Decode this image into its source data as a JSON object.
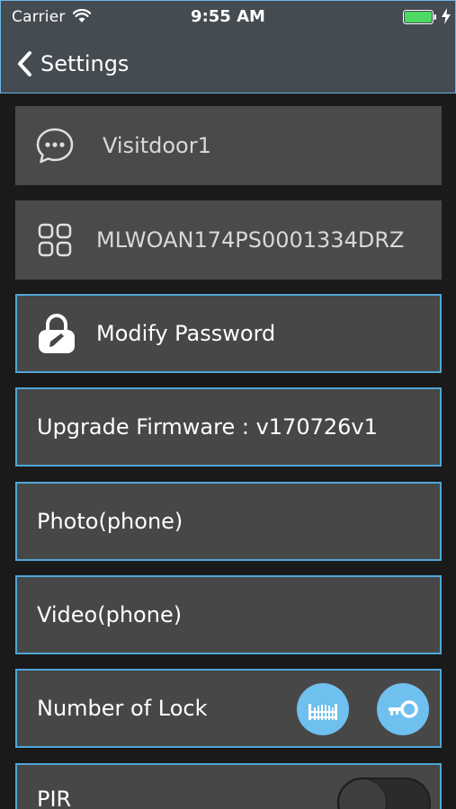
{
  "status_bar": {
    "carrier": "Carrier",
    "time": "9:55 AM",
    "battery_color": "#4cd964",
    "wifi_icon": "wifi-icon",
    "battery_icon": "battery-icon",
    "charging_icon": "charging-bolt-icon"
  },
  "nav": {
    "back_label": "Settings",
    "back_icon": "chevron-left-icon"
  },
  "settings": {
    "device_name": "Visitdoor1",
    "device_id": "MLWOAN174PS0001334DRZ",
    "modify_password": "Modify Password",
    "upgrade_firmware": "Upgrade Firmware : v170726v1",
    "photo": "Photo(phone)",
    "video": "Video(phone)",
    "number_of_lock": "Number of Lock",
    "pir": "PIR",
    "pir_enabled": false
  },
  "colors": {
    "header_bg": "#444b51",
    "accent_border": "#4fa6d6",
    "lock_button_bg": "#6fc0ef",
    "row_bg": "#4a4a4a"
  }
}
